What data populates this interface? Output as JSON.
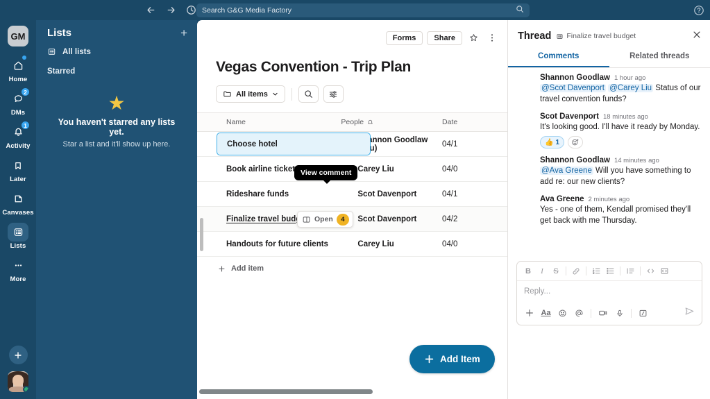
{
  "topbar": {
    "back_icon": "arrow-left-icon",
    "forward_icon": "arrow-right-icon",
    "history_icon": "clock-icon",
    "search_placeholder": "Search G&G Media Factory",
    "search_value": "Search G&G Media Factory",
    "help_icon": "help-icon"
  },
  "rail": {
    "workspace_initials": "GM",
    "items": [
      {
        "label": "Home",
        "icon": "home-icon",
        "badge": "",
        "dot": true,
        "active": false
      },
      {
        "label": "DMs",
        "icon": "dm-icon",
        "badge": "2",
        "dot": false,
        "active": false
      },
      {
        "label": "Activity",
        "icon": "bell-icon",
        "badge": "1",
        "dot": false,
        "active": false
      },
      {
        "label": "Later",
        "icon": "bookmark-icon",
        "badge": "",
        "dot": false,
        "active": false
      },
      {
        "label": "Canvases",
        "icon": "canvas-icon",
        "badge": "",
        "dot": false,
        "active": false
      },
      {
        "label": "Lists",
        "icon": "lists-icon",
        "badge": "",
        "dot": false,
        "active": true
      },
      {
        "label": "More",
        "icon": "more-icon",
        "badge": "",
        "dot": false,
        "active": false
      }
    ],
    "new_button_icon": "plus-icon",
    "avatar_name": "avatar",
    "presence": "active"
  },
  "sidebar": {
    "title": "Lists",
    "add_icon": "plus-icon",
    "all_lists_label": "All lists",
    "all_lists_icon": "lists-icon",
    "starred_label": "Starred",
    "empty": {
      "star_icon": "star-icon",
      "title": "You haven't starred any lists yet.",
      "subtitle": "Star a list and it'll show up here."
    }
  },
  "main": {
    "toolbar": {
      "forms_label": "Forms",
      "share_label": "Share",
      "star_icon": "star-outline-icon",
      "more_icon": "kebab-menu-icon"
    },
    "page_title": "Vegas Convention - Trip Plan",
    "filters": {
      "view_label": "All items",
      "view_icon": "folder-icon",
      "view_chevron": "chevron-down-icon",
      "search_icon": "search-icon",
      "settings_icon": "sliders-icon"
    },
    "table": {
      "columns": [
        "Name",
        "People",
        "Date"
      ],
      "people_header_icon": "bell-icon",
      "rows": [
        {
          "name": "Choose hotel",
          "person": "Shannon Goodlaw (you)",
          "date": "04/1",
          "selected": true,
          "underline": false
        },
        {
          "name": "Book airline tickets",
          "person": "Carey Liu",
          "date": "04/0",
          "selected": false,
          "underline": false
        },
        {
          "name": "Rideshare funds",
          "person": "Scot Davenport",
          "date": "04/1",
          "selected": false,
          "underline": false
        },
        {
          "name": "Finalize travel budget",
          "person": "Scot Davenport",
          "date": "04/2",
          "selected": false,
          "underline": true
        },
        {
          "name": "Handouts for future clients",
          "person": "Carey Liu",
          "date": "04/0",
          "selected": false,
          "underline": false
        }
      ]
    },
    "open_chip": {
      "label": "Open",
      "count": "4",
      "icon": "panel-icon"
    },
    "tooltip": "View comment",
    "add_item_label": "Add item",
    "add_item_icon": "plus-icon",
    "fab_label": "Add Item",
    "fab_icon": "plus-icon"
  },
  "thread": {
    "title": "Thread",
    "subject": "Finalize travel budget",
    "subject_icon": "lists-icon",
    "close_icon": "close-icon",
    "tabs": [
      {
        "label": "Comments",
        "active": true
      },
      {
        "label": "Related threads",
        "active": false
      }
    ],
    "messages": [
      {
        "author": "Shannon Goodlaw",
        "time": "1 hour ago",
        "mentions": [
          "@Scot Davenport",
          "@Carey Liu"
        ],
        "text": " Status of our travel convention funds?",
        "reactions": []
      },
      {
        "author": "Scot Davenport",
        "time": "18 minutes ago",
        "mentions": [],
        "text": "It's looking good. I'll have it ready by Monday.",
        "reactions": [
          {
            "emoji": "👍",
            "count": "1"
          }
        ]
      },
      {
        "author": "Shannon Goodlaw",
        "time": "14 minutes ago",
        "mentions": [
          "@Ava Greene"
        ],
        "text": " Will you have something to add re: our new clients?",
        "reactions": []
      },
      {
        "author": "Ava Greene",
        "time": "2 minutes ago",
        "mentions": [],
        "text": "Yes - one of them, Kendall promised they'll get back with me Thursday.",
        "reactions": []
      }
    ],
    "composer": {
      "placeholder": "Reply...",
      "format_buttons": [
        "bold-icon",
        "italic-icon",
        "strikethrough-icon",
        "link-icon",
        "ordered-list-icon",
        "bullet-list-icon",
        "blockquote-icon",
        "code-icon",
        "code-block-icon"
      ],
      "action_buttons": [
        "plus-icon",
        "formatting-icon",
        "emoji-icon",
        "mention-icon",
        "video-icon",
        "microphone-icon",
        "slash-command-icon"
      ],
      "send_icon": "send-icon"
    }
  },
  "colors": {
    "slack_aubergine": "#1a4866",
    "sidebar": "#205274",
    "accent_blue": "#1264a3",
    "fab_blue": "#0b6e9f",
    "selected_row": "#e4f3fb",
    "selected_border": "#3daee8",
    "badge_yellow": "#f0b323",
    "badge_blue": "#38a5f0",
    "presence_green": "#2bac76",
    "star_yellow": "#f2c744"
  }
}
